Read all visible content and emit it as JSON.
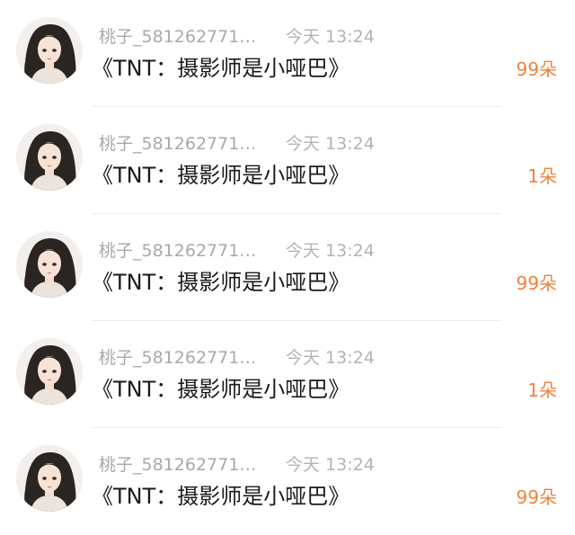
{
  "items": [
    {
      "username": "桃子_581262771…",
      "time": "今天 13:24",
      "message": "《TNT：摄影师是小哑巴》",
      "gift": "99朵"
    },
    {
      "username": "桃子_581262771…",
      "time": "今天 13:24",
      "message": "《TNT：摄影师是小哑巴》",
      "gift": "1朵"
    },
    {
      "username": "桃子_581262771…",
      "time": "今天 13:24",
      "message": "《TNT：摄影师是小哑巴》",
      "gift": "99朵"
    },
    {
      "username": "桃子_581262771…",
      "time": "今天 13:24",
      "message": "《TNT：摄影师是小哑巴》",
      "gift": "1朵"
    },
    {
      "username": "桃子_581262771…",
      "time": "今天 13:24",
      "message": "《TNT：摄影师是小哑巴》",
      "gift": "99朵"
    }
  ],
  "colors": {
    "gift": "#f0823c",
    "meta": "#a9a9a9",
    "message": "#1a1a1a"
  },
  "icons": {
    "avatar": "girl-portrait-avatar"
  }
}
